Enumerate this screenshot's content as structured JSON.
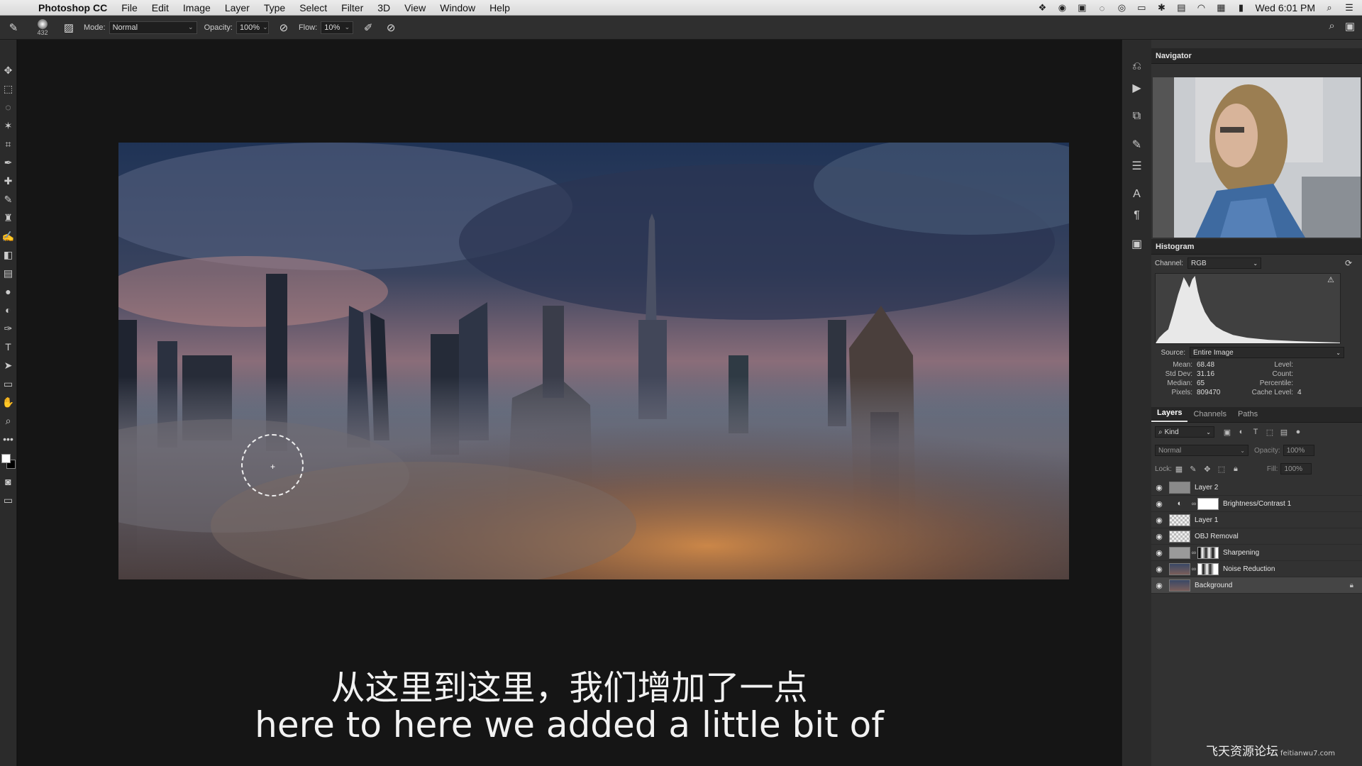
{
  "menubar": {
    "app_name": "Photoshop CC",
    "items": [
      "File",
      "Edit",
      "Image",
      "Layer",
      "Type",
      "Select",
      "Filter",
      "3D",
      "View",
      "Window",
      "Help"
    ],
    "clock": "Wed 6:01 PM"
  },
  "options_bar": {
    "brush_size": "432",
    "mode_label": "Mode:",
    "mode_value": "Normal",
    "opacity_label": "Opacity:",
    "opacity_value": "100%",
    "flow_label": "Flow:",
    "flow_value": "10%"
  },
  "canvas": {
    "subtitle_cn": "从这里到这里，我们增加了一点",
    "subtitle_en": "here to here we added a little bit of"
  },
  "navigator": {
    "title": "Navigator"
  },
  "histogram": {
    "title": "Histogram",
    "channel_label": "Channel:",
    "channel_value": "RGB",
    "source_label": "Source:",
    "source_value": "Entire Image",
    "stats_left": [
      {
        "key": "Mean:",
        "value": "68.48"
      },
      {
        "key": "Std Dev:",
        "value": "31.16"
      },
      {
        "key": "Median:",
        "value": "65"
      },
      {
        "key": "Pixels:",
        "value": "809470"
      }
    ],
    "stats_right": [
      {
        "key": "Level:",
        "value": ""
      },
      {
        "key": "Count:",
        "value": ""
      },
      {
        "key": "Percentile:",
        "value": ""
      },
      {
        "key": "Cache Level:",
        "value": "4"
      }
    ]
  },
  "layers_panel": {
    "tabs": [
      "Layers",
      "Channels",
      "Paths"
    ],
    "kind_label": "Kind",
    "blend_mode": "Normal",
    "opacity_label": "Opacity:",
    "opacity_value": "100%",
    "lock_label": "Lock:",
    "fill_label": "Fill:",
    "fill_value": "100%",
    "layers": [
      {
        "name": "Layer 2"
      },
      {
        "name": "Brightness/Contrast 1"
      },
      {
        "name": "Layer 1"
      },
      {
        "name": "OBJ Removal"
      },
      {
        "name": "Sharpening"
      },
      {
        "name": "Noise Reduction"
      },
      {
        "name": "Background"
      }
    ]
  },
  "watermark": {
    "main": "飞天资源论坛",
    "small": "feitianwu7.com"
  }
}
